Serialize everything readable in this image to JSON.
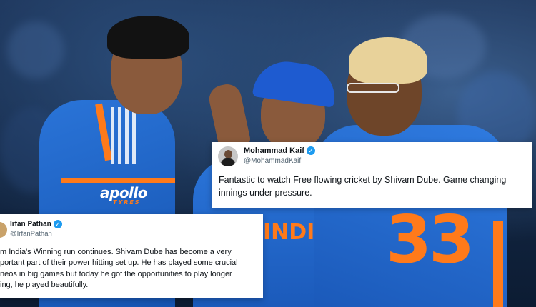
{
  "jersey": {
    "sponsor": "apollo",
    "sponsor_sub": "TYRES",
    "number": "33",
    "chest": "INDIA"
  },
  "tweets": [
    {
      "name": "Mohammad Kaif",
      "handle": "@MohammadKaif",
      "text": "Fantastic to watch Free flowing cricket by Shivam Dube. Game changing innings under pressure."
    },
    {
      "name": "Irfan Pathan",
      "handle": "@IrfanPathan",
      "lines": [
        "m India's Winning run continues. Shivam Dube has become a very",
        "portant part of their power hitting set up. He has played some crucial",
        "neos in big games but today he got the opportunities to play longer",
        "ing, he played beautifully."
      ]
    }
  ],
  "colors": {
    "jersey_blue": "#1f63c6",
    "jersey_orange": "#ff7a1a",
    "cap_blue": "#1e5bd0",
    "verified": "#1d9bf0"
  },
  "icons": [
    "verified-badge-icon",
    "avatar"
  ]
}
